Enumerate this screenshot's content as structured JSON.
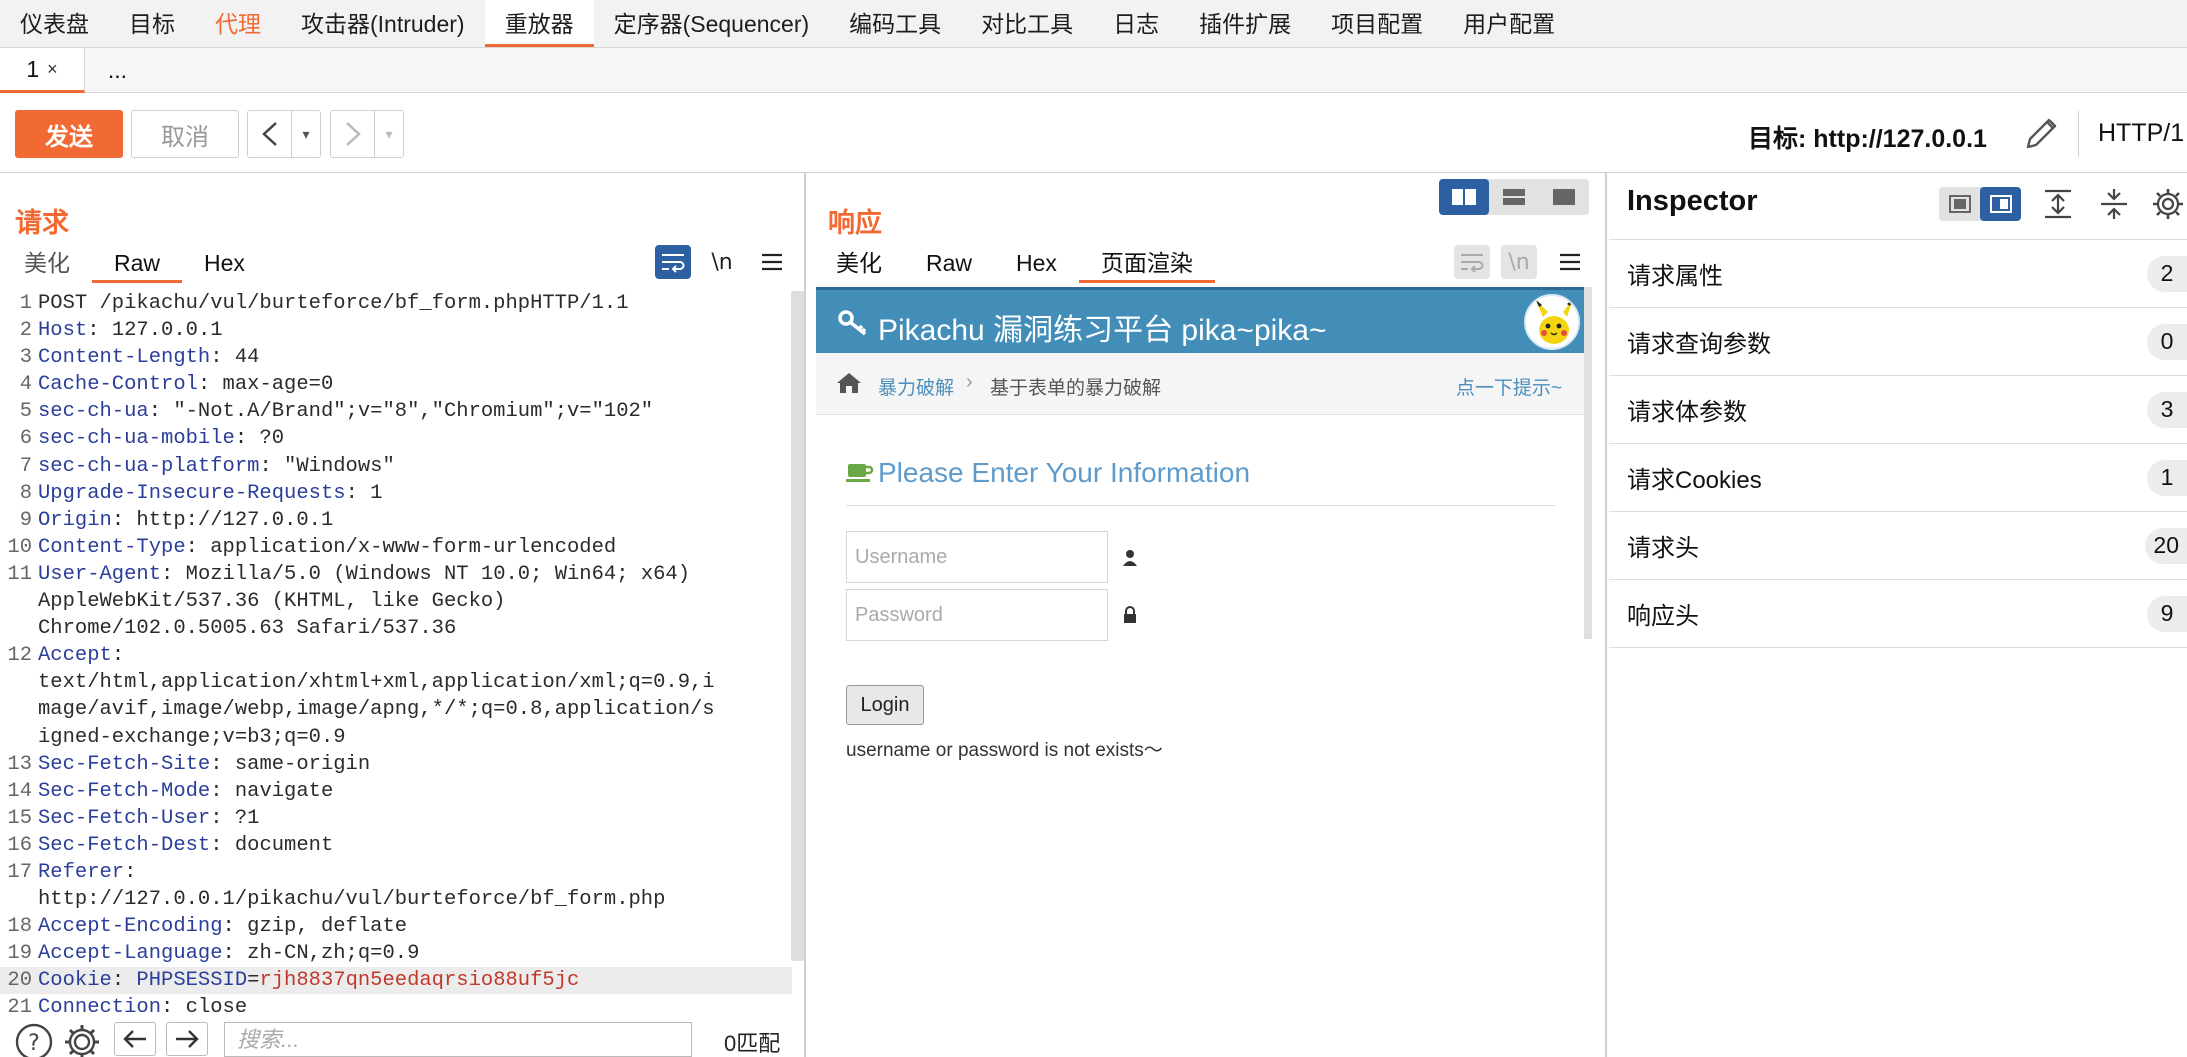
{
  "menu": {
    "items": [
      "仪表盘",
      "目标",
      "代理",
      "攻击器(Intruder)",
      "重放器",
      "定序器(Sequencer)",
      "编码工具",
      "对比工具",
      "日志",
      "插件扩展",
      "项目配置",
      "用户配置"
    ]
  },
  "tabs": {
    "items": [
      {
        "label": "1",
        "close": "×"
      }
    ],
    "more": "..."
  },
  "toolbar": {
    "send": "发送",
    "cancel": "取消",
    "back_arrow": "<",
    "forward_arrow": ">",
    "dropdown": "▾",
    "target": "目标: http://127.0.0.1",
    "http_version": "HTTP/1"
  },
  "request": {
    "title": "请求",
    "tabs": {
      "pretty": "美化",
      "raw": "Raw",
      "hex": "Hex"
    },
    "newline_toggle": "\\n",
    "lines": [
      {
        "n": "1",
        "plain": "POST /pikachu/vul/burteforce/bf_form.phpHTTP/1.1"
      },
      {
        "n": "2",
        "key": "Host",
        "val": "127.0.0.1"
      },
      {
        "n": "3",
        "key": "Content-Length",
        "val": "44"
      },
      {
        "n": "4",
        "key": "Cache-Control",
        "val": "max-age=0"
      },
      {
        "n": "5",
        "key": "sec-ch-ua",
        "val": "\"-Not.A/Brand\";v=\"8\",\"Chromium\";v=\"102\""
      },
      {
        "n": "6",
        "key": "sec-ch-ua-mobile",
        "val": "?0"
      },
      {
        "n": "7",
        "key": "sec-ch-ua-platform",
        "val": "\"Windows\""
      },
      {
        "n": "8",
        "key": "Upgrade-Insecure-Requests",
        "val": "1"
      },
      {
        "n": "9",
        "key": "Origin",
        "val": "http://127.0.0.1"
      },
      {
        "n": "10",
        "key": "Content-Type",
        "val": "application/x-www-form-urlencoded"
      },
      {
        "n": "11",
        "key": "User-Agent",
        "val": "Mozilla/5.0 (Windows NT 10.0; Win64; x64)"
      },
      {
        "n": "",
        "plain": "AppleWebKit/537.36 (KHTML, like Gecko)"
      },
      {
        "n": "",
        "plain": "Chrome/102.0.5005.63 Safari/537.36"
      },
      {
        "n": "12",
        "key": "Accept",
        "val": ""
      },
      {
        "n": "",
        "plain": "text/html,application/xhtml+xml,application/xml;q=0.9,i"
      },
      {
        "n": "",
        "plain": "mage/avif,image/webp,image/apng,*/*;q=0.8,application/s"
      },
      {
        "n": "",
        "plain": "igned-exchange;v=b3;q=0.9"
      },
      {
        "n": "13",
        "key": "Sec-Fetch-Site",
        "val": "same-origin"
      },
      {
        "n": "14",
        "key": "Sec-Fetch-Mode",
        "val": "navigate"
      },
      {
        "n": "15",
        "key": "Sec-Fetch-User",
        "val": "?1"
      },
      {
        "n": "16",
        "key": "Sec-Fetch-Dest",
        "val": "document"
      },
      {
        "n": "17",
        "key": "Referer",
        "val": ""
      },
      {
        "n": "",
        "plain": "http://127.0.0.1/pikachu/vul/burteforce/bf_form.php"
      },
      {
        "n": "18",
        "key": "Accept-Encoding",
        "val": "gzip, deflate"
      },
      {
        "n": "19",
        "key": "Accept-Language",
        "val": "zh-CN,zh;q=0.9"
      },
      {
        "n": "20",
        "key": "Cookie",
        "val": "PHPSESSID",
        "cookie_val": "rjh8837qn5eedaqrsio88uf5jc",
        "highlight": true
      },
      {
        "n": "21",
        "key": "Connection",
        "val": "close"
      }
    ],
    "search": {
      "placeholder": "搜索...",
      "matches": "0匹配"
    }
  },
  "response": {
    "title": "响应",
    "tabs": {
      "pretty": "美化",
      "raw": "Raw",
      "hex": "Hex",
      "render": "页面渲染"
    },
    "newline_toggle": "\\n",
    "page": {
      "header_title": "Pikachu 漏洞练习平台 pika~pika~",
      "breadcrumb_1": "暴力破解",
      "breadcrumb_sep": "›",
      "breadcrumb_2": "基于表单的暴力破解",
      "hint": "点一下提示~",
      "form_title": "Please Enter Your Information",
      "username_placeholder": "Username",
      "password_placeholder": "Password",
      "login": "Login",
      "message": "username or password is not exists～"
    }
  },
  "inspector": {
    "title": "Inspector",
    "rows": [
      {
        "label": "请求属性",
        "count": "2"
      },
      {
        "label": "请求查询参数",
        "count": "0"
      },
      {
        "label": "请求体参数",
        "count": "3"
      },
      {
        "label": "请求Cookies",
        "count": "1"
      },
      {
        "label": "请求头",
        "count": "20"
      },
      {
        "label": "响应头",
        "count": "9"
      }
    ]
  },
  "colors": {
    "accent": "#f26a33",
    "selected": "#2d5fa3",
    "header_key": "#2b3e9b",
    "cookie_value": "#c0392b",
    "pikachu_header": "#438eb9"
  }
}
